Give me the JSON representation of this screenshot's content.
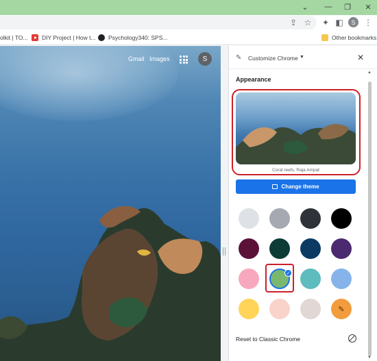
{
  "bookmarks": [
    {
      "label": "olkit | TO..."
    },
    {
      "label": "DIY Project | How t..."
    },
    {
      "label": "Psychology340: SPS..."
    },
    {
      "label": "Other bookmarks"
    }
  ],
  "profile_initial": "S",
  "ntp": {
    "gmail": "Gmail",
    "images": "Images"
  },
  "panel": {
    "title": "Customize Chrome",
    "section": "Appearance",
    "theme_caption": "Coral reefs, Raja Ampat",
    "change_theme": "Change theme",
    "reset": "Reset to Classic Chrome"
  },
  "colors": {
    "swatches": [
      "#dee1e6",
      "#a6a8b2",
      "#2f3339",
      "#000000",
      "#5c1138",
      "#0d3b36",
      "#0d3a63",
      "#4b2a70",
      "#f7a8bf",
      "#7bb86f",
      "#5ebbbe",
      "#86b4ea",
      "#ffd458",
      "#f9d3c9",
      "#e1d7d4",
      "#f29c3e"
    ],
    "selected": "#7bb86f",
    "accent": "#1a73e8",
    "highlight": "#cc2027",
    "titlebar": "#a5d7a3"
  }
}
